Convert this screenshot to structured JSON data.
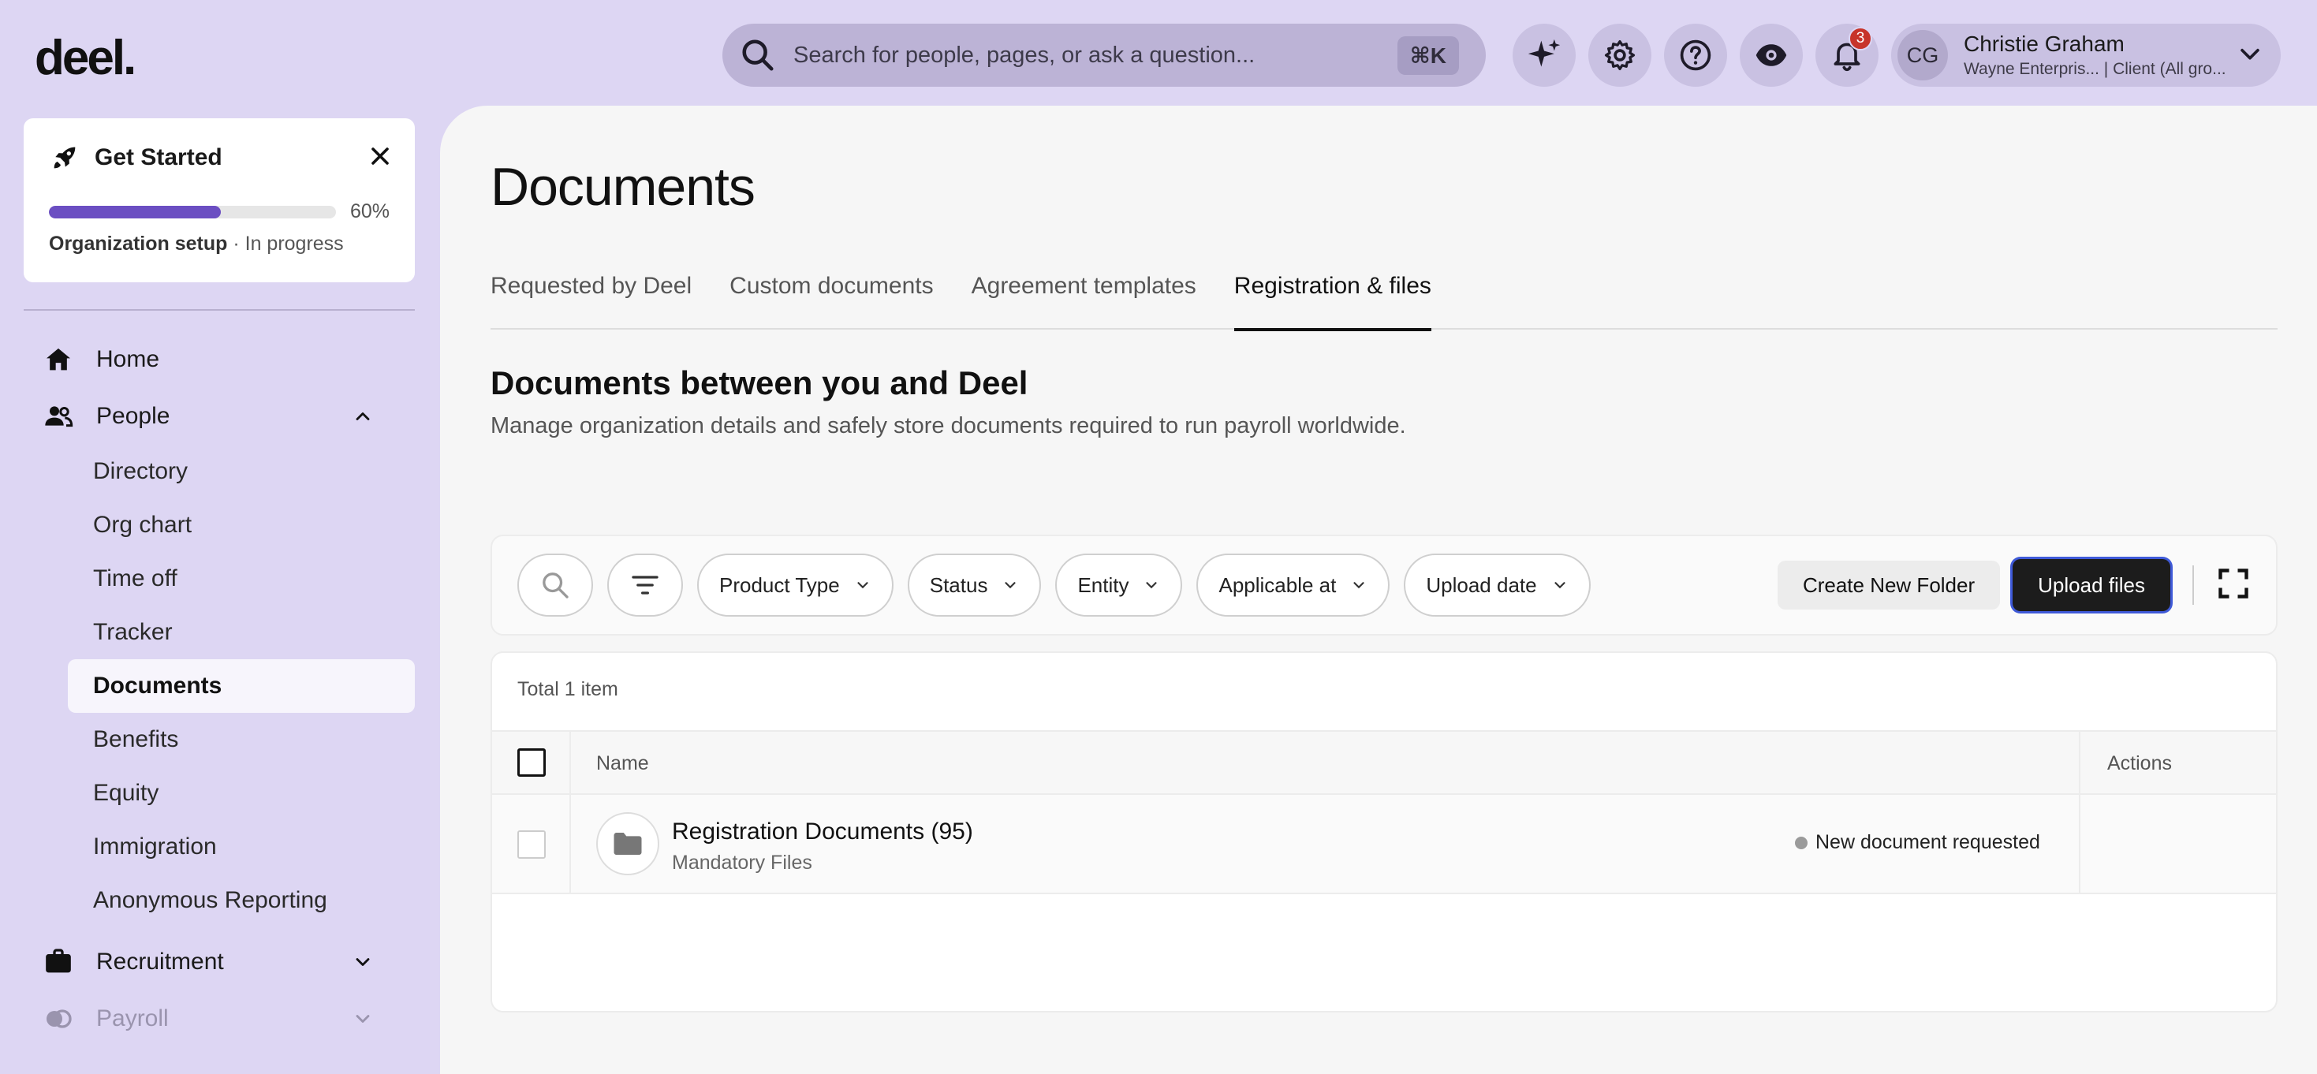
{
  "brand": {
    "logo": "deel."
  },
  "search": {
    "placeholder": "Search for people, pages, or ask a question...",
    "shortcut": "⌘K"
  },
  "topbar": {
    "notifications_count": "3"
  },
  "user": {
    "initials": "CG",
    "name": "Christie Graham",
    "subtitle": "Wayne Enterpris... | Client (All gro..."
  },
  "get_started": {
    "title": "Get Started",
    "progress_pct": 60,
    "progress_label": "60%",
    "status_bold": "Organization setup",
    "status_rest": " · In progress"
  },
  "sidebar": {
    "home": "Home",
    "people": "People",
    "people_items": [
      "Directory",
      "Org chart",
      "Time off",
      "Tracker",
      "Documents",
      "Benefits",
      "Equity",
      "Immigration",
      "Anonymous Reporting"
    ],
    "active_item": "Documents",
    "recruitment": "Recruitment",
    "payroll": "Payroll"
  },
  "page": {
    "title": "Documents",
    "tabs": [
      "Requested by Deel",
      "Custom documents",
      "Agreement templates",
      "Registration & files"
    ],
    "active_tab": "Registration & files",
    "section_title": "Documents between you and Deel",
    "section_sub": "Manage organization details and safely store documents required to run payroll worldwide."
  },
  "toolbar": {
    "filters": [
      "Product Type",
      "Status",
      "Entity",
      "Applicable at",
      "Upload date"
    ],
    "create_folder": "Create New Folder",
    "upload": "Upload files"
  },
  "table": {
    "total": "Total 1 item",
    "col_name": "Name",
    "col_actions": "Actions",
    "rows": [
      {
        "title": "Registration Documents (95)",
        "subtitle": "Mandatory Files",
        "status": "New document requested"
      }
    ]
  }
}
